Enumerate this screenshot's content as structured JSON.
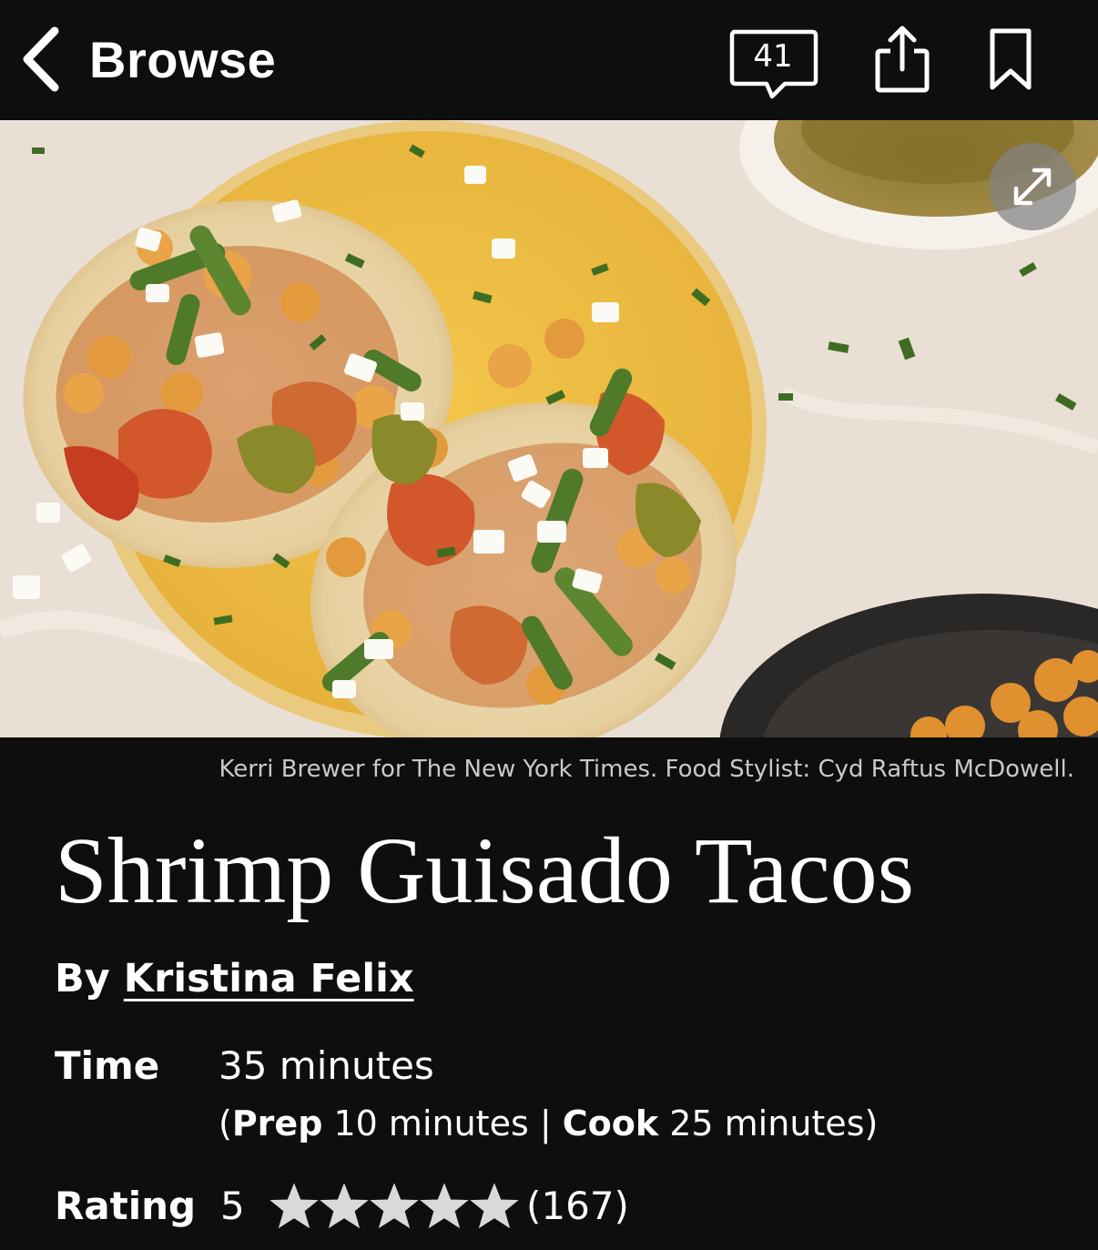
{
  "nav": {
    "back_label": "Browse",
    "back_icon": "chevron-left-icon",
    "comments_count": "41",
    "comments_icon": "comment-bubble-icon",
    "share_icon": "share-icon",
    "bookmark_icon": "bookmark-icon"
  },
  "hero": {
    "expand_icon": "expand-icon"
  },
  "photo_credit": "Kerri Brewer for The New York Times. Food Stylist: Cyd Raftus McDowell.",
  "recipe": {
    "title": "Shrimp Guisado Tacos",
    "by_label": "By",
    "author": "Kristina Felix",
    "time_label": "Time",
    "total_time": "35 minutes",
    "prep_open": "(",
    "prep_label": "Prep",
    "prep_time": "10 minutes",
    "separator": "|",
    "cook_label": "Cook",
    "cook_time": "25 minutes",
    "prep_close": ")",
    "rating_label": "Rating",
    "rating_value": "5",
    "stars_filled": 5,
    "stars_total": 5,
    "rating_count": "(167)"
  },
  "colors": {
    "background": "#0e0e0e",
    "text": "#ffffff",
    "credit_text": "#c9c9c9",
    "star": "#d9d9d9"
  }
}
